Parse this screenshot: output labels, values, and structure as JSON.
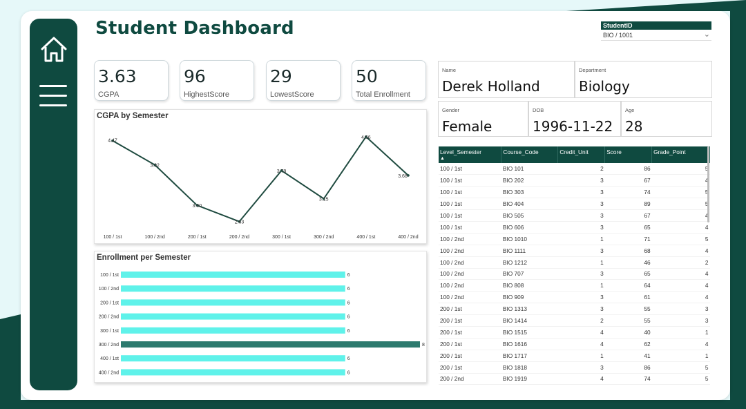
{
  "title": "Student Dashboard",
  "slicer": {
    "label": "StudentID",
    "value": "BIO / 1001"
  },
  "kpis": [
    {
      "value": "3.63",
      "label": "CGPA"
    },
    {
      "value": "96",
      "label": "HighestScore"
    },
    {
      "value": "29",
      "label": "LowestScore"
    },
    {
      "value": "50",
      "label": "Total Enrollment"
    }
  ],
  "student": {
    "name_label": "Name",
    "name": "Derek Holland",
    "department_label": "Department",
    "department": "Biology",
    "gender_label": "Gender",
    "gender": "Female",
    "dob_label": "DOB",
    "dob": "1996-11-22",
    "age_label": "Age",
    "age": "28"
  },
  "colors": {
    "primary": "#0f4a40",
    "bar": "#5ff2ea",
    "bar_highlight": "#2d7a6e",
    "line": "#1e4a3f"
  },
  "chart_data": [
    {
      "type": "line",
      "title": "CGPA by Semester",
      "categories": [
        "100 / 1st",
        "100 / 2nd",
        "200 / 1st",
        "200 / 2nd",
        "300 / 1st",
        "300 / 2nd",
        "400 / 1st",
        "400 / 2nd"
      ],
      "values": [
        4.47,
        3.92,
        3.0,
        2.63,
        3.79,
        3.15,
        4.56,
        3.68
      ],
      "labels": [
        "4.47",
        "3.92",
        "3.00",
        "2.63",
        "3.79",
        "3.15",
        "4.56",
        "3.68"
      ],
      "ylim": [
        2.5,
        4.7
      ],
      "grid": false
    },
    {
      "type": "bar",
      "orientation": "horizontal",
      "title": "Enrollment per Semester",
      "categories": [
        "100 / 1st",
        "100 / 2nd",
        "200 / 1st",
        "200 / 2nd",
        "300 / 1st",
        "300 / 2nd",
        "400 / 1st",
        "400 / 2nd"
      ],
      "values": [
        6,
        6,
        6,
        6,
        6,
        8,
        6,
        6
      ],
      "highlight_index": 5,
      "xlim": [
        0,
        8
      ],
      "grid": false
    }
  ],
  "table": {
    "columns": [
      "Level_Semester",
      "Course_Code",
      "Credit_Unit",
      "Score",
      "Grade_Point"
    ],
    "sort_indicator": "▲",
    "rows": [
      [
        "100 / 1st",
        "BIO 101",
        "2",
        "86",
        "5"
      ],
      [
        "100 / 1st",
        "BIO 202",
        "3",
        "67",
        "4"
      ],
      [
        "100 / 1st",
        "BIO 303",
        "3",
        "74",
        "5"
      ],
      [
        "100 / 1st",
        "BIO 404",
        "3",
        "89",
        "5"
      ],
      [
        "100 / 1st",
        "BIO 505",
        "3",
        "67",
        "4"
      ],
      [
        "100 / 1st",
        "BIO 606",
        "3",
        "65",
        "4"
      ],
      [
        "100 / 2nd",
        "BIO 1010",
        "1",
        "71",
        "5"
      ],
      [
        "100 / 2nd",
        "BIO 1111",
        "3",
        "68",
        "4"
      ],
      [
        "100 / 2nd",
        "BIO 1212",
        "1",
        "46",
        "2"
      ],
      [
        "100 / 2nd",
        "BIO 707",
        "3",
        "65",
        "4"
      ],
      [
        "100 / 2nd",
        "BIO 808",
        "1",
        "64",
        "4"
      ],
      [
        "100 / 2nd",
        "BIO 909",
        "3",
        "61",
        "4"
      ],
      [
        "200 / 1st",
        "BIO 1313",
        "3",
        "55",
        "3"
      ],
      [
        "200 / 1st",
        "BIO 1414",
        "2",
        "55",
        "3"
      ],
      [
        "200 / 1st",
        "BIO 1515",
        "4",
        "40",
        "1"
      ],
      [
        "200 / 1st",
        "BIO 1616",
        "4",
        "62",
        "4"
      ],
      [
        "200 / 1st",
        "BIO 1717",
        "1",
        "41",
        "1"
      ],
      [
        "200 / 1st",
        "BIO 1818",
        "3",
        "86",
        "5"
      ],
      [
        "200 / 2nd",
        "BIO 1919",
        "4",
        "74",
        "5"
      ]
    ]
  }
}
